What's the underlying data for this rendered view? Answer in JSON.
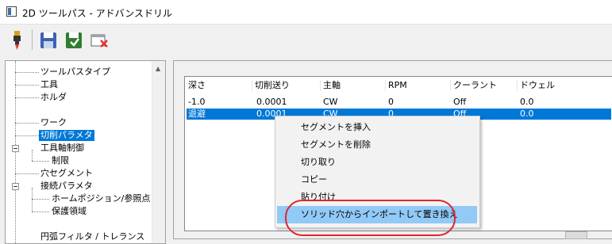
{
  "window": {
    "title": "2D ツールパス - アドバンスドリル"
  },
  "toolbar": {
    "buttons": [
      "drill-icon",
      "save-icon",
      "save-export-icon",
      "delete-window-icon"
    ]
  },
  "tree": {
    "items": [
      {
        "label": "ツールパスタイプ"
      },
      {
        "label": "工具"
      },
      {
        "label": "ホルダ"
      },
      {
        "label": "ワーク"
      },
      {
        "label": "切削パラメタ",
        "selected": true
      },
      {
        "label": "工具軸制御"
      },
      {
        "label": "制限"
      },
      {
        "label": "穴セグメント"
      },
      {
        "label": "接続パラメタ"
      },
      {
        "label": "ホームポジション/参照点"
      },
      {
        "label": "保護領域"
      },
      {
        "label": "円弧フィルタ / トレランス"
      }
    ]
  },
  "table": {
    "headers": [
      "深さ",
      "切削送り",
      "主軸",
      "RPM",
      "クーラント",
      "ドウェル"
    ],
    "rows": [
      [
        "-1.0",
        "0.0001",
        "CW",
        "0",
        "Off",
        "0.0"
      ],
      [
        "退避",
        "0.0001",
        "CW",
        "0",
        "Off",
        "0.0"
      ]
    ]
  },
  "context_menu": {
    "items": [
      "セグメントを挿入",
      "セグメントを削除",
      "切り取り",
      "コピー",
      "貼り付け",
      "ソリッド穴からインポートして置き換え"
    ],
    "highlighted_index": 5,
    "accent": "#e0262a"
  },
  "colors": {
    "selection": "#0078d7",
    "menu_hover": "#91c9f7"
  }
}
